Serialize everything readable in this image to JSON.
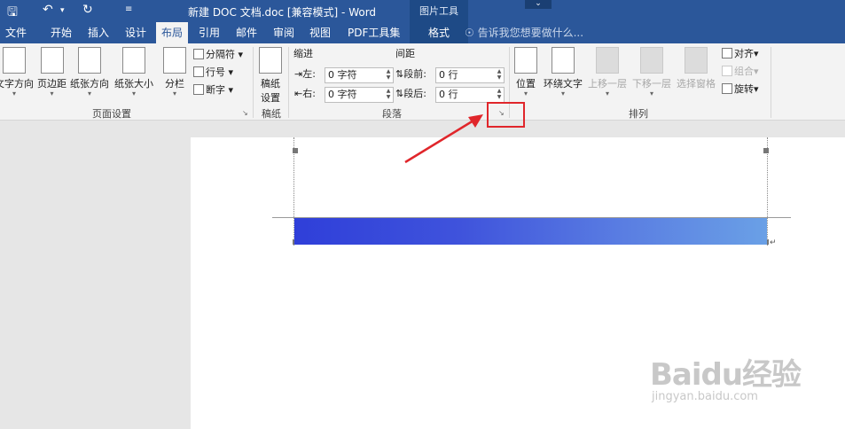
{
  "window": {
    "title": "新建 DOC 文档.doc [兼容模式] - Word",
    "contextual_group": "图片工具",
    "quick_access": {
      "save_icon": "save-icon",
      "undo_icon": "undo-icon",
      "redo_icon": "redo-icon",
      "customize_icon": "customize-icon"
    }
  },
  "tabs": {
    "file": "文件",
    "home": "开始",
    "insert": "插入",
    "design": "设计",
    "layout": "布局",
    "references": "引用",
    "mailings": "邮件",
    "review": "审阅",
    "view": "视图",
    "pdf": "PDF工具集",
    "format": "格式",
    "tell_me": "告诉我您想要做什么..."
  },
  "page_setup": {
    "group_label": "页面设置",
    "text_direction": "文字方向",
    "margins": "页边距",
    "orientation": "纸张方向",
    "size": "纸张大小",
    "columns": "分栏",
    "breaks": "分隔符",
    "line_numbers": "行号",
    "hyphenation": "断字"
  },
  "draft_paper": {
    "group_label": "稿纸",
    "button_line1": "稿纸",
    "button_line2": "设置"
  },
  "paragraph": {
    "group_label": "段落",
    "indent_header": "缩进",
    "spacing_header": "间距",
    "left_label": "左:",
    "left_value": "0 字符",
    "right_label": "右:",
    "right_value": "0 字符",
    "before_label": "段前:",
    "before_value": "0 行",
    "after_label": "段后:",
    "after_value": "0 行"
  },
  "arrange": {
    "group_label": "排列",
    "position": "位置",
    "wrap_text": "环绕文字",
    "bring_forward": "上移一层",
    "send_backward": "下移一层",
    "selection_pane": "选择窗格",
    "align": "对齐",
    "group": "组合",
    "rotate": "旋转"
  },
  "watermark": {
    "brand": "Baidu经验",
    "site": "jingyan.baidu.com"
  },
  "colors": {
    "title_bar": "#2b579a",
    "annotation_red": "#e0262b"
  }
}
